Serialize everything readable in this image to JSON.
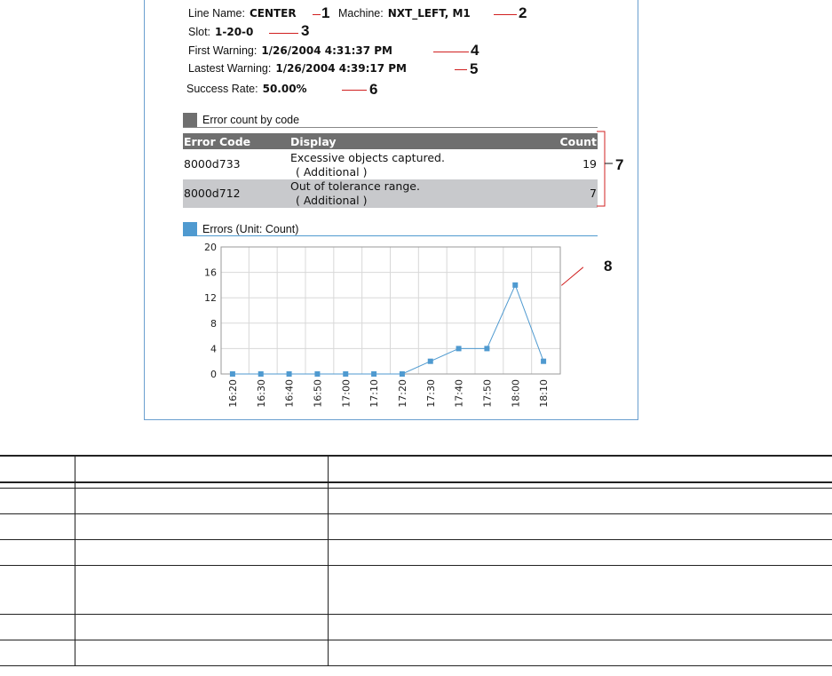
{
  "info": {
    "line_name_label": "Line Name:",
    "line_name_value": "CENTER",
    "machine_label": "Machine:",
    "machine_value": "NXT_LEFT, M1",
    "slot_label": "Slot:",
    "slot_value": "1-20-0",
    "first_warning_label": "First Warning:",
    "first_warning_value": "1/26/2004 4:31:37 PM",
    "last_warning_label": "Lastest Warning:",
    "last_warning_value": "1/26/2004 4:39:17 PM",
    "success_rate_label": "Success Rate:",
    "success_rate_value": "50.00%"
  },
  "callouts": [
    "1",
    "2",
    "3",
    "4",
    "5",
    "6",
    "7",
    "8"
  ],
  "error_section": {
    "title": "Error count by code",
    "headers": [
      "Error Code",
      "Display",
      "Count"
    ],
    "rows": [
      {
        "code": "8000d733",
        "display": "Excessive objects captured.",
        "extra": "( Additional )",
        "count": "19"
      },
      {
        "code": "8000d712",
        "display": "Out of tolerance range.",
        "extra": "( Additional )",
        "count": "7"
      }
    ]
  },
  "chart_section": {
    "title": "Errors (Unit: Count)"
  },
  "chart_data": {
    "type": "line",
    "title": "Errors (Unit: Count)",
    "categories": [
      "16:20",
      "16:30",
      "16:40",
      "16:50",
      "17:00",
      "17:10",
      "17:20",
      "17:30",
      "17:40",
      "17:50",
      "18:00",
      "18:10"
    ],
    "values": [
      0,
      0,
      0,
      0,
      0,
      0,
      0,
      2,
      4,
      4,
      14,
      2
    ],
    "yticks": [
      "0",
      "4",
      "8",
      "12",
      "16",
      "20"
    ],
    "ylim": [
      0,
      20
    ],
    "grid": true,
    "color": "#4f9ad0"
  },
  "colors": {
    "panel_border": "#6a9fcf",
    "callout_line": "#d02020",
    "header_bg": "#6f6f6f",
    "row_alt_bg": "#c8c9cc",
    "series": "#4f9ad0"
  }
}
